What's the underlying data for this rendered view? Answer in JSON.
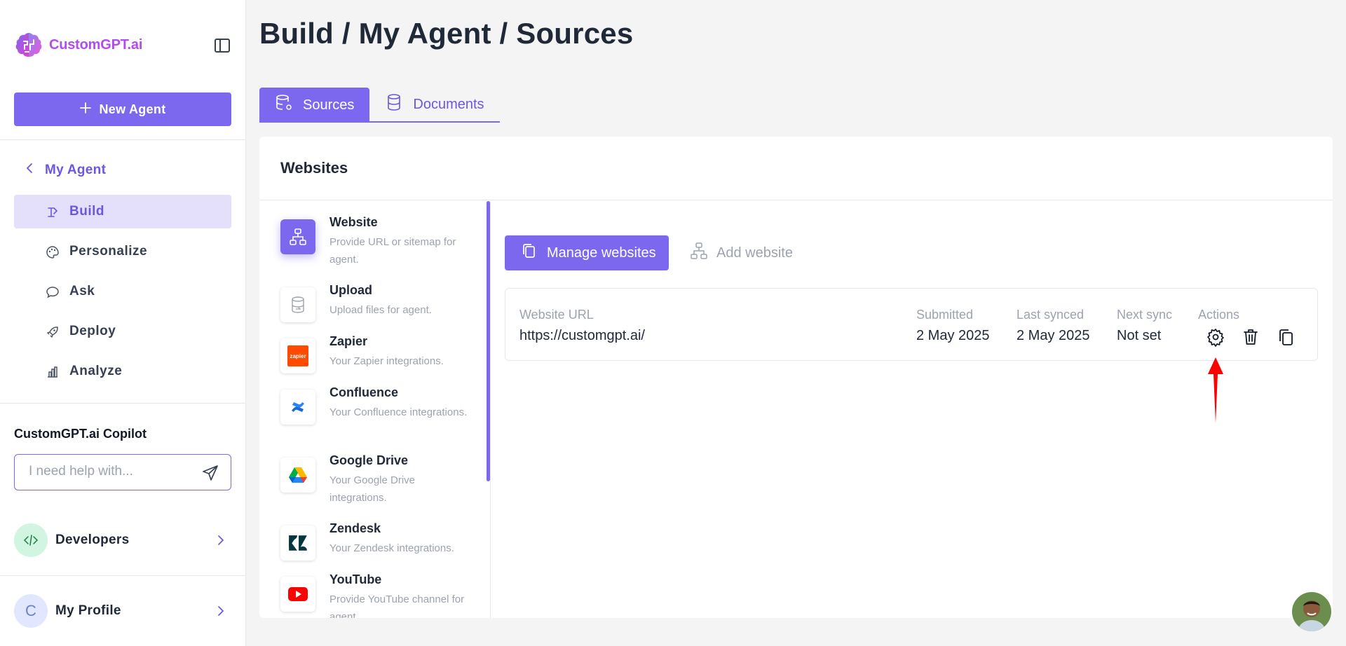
{
  "brand": {
    "name": "CustomGPT.ai"
  },
  "sidebar": {
    "new_agent": "New Agent",
    "back_label": "My Agent",
    "nav": [
      {
        "label": "Build",
        "icon": "build-icon",
        "active": true
      },
      {
        "label": "Personalize",
        "icon": "palette-icon",
        "active": false
      },
      {
        "label": "Ask",
        "icon": "chat-icon",
        "active": false
      },
      {
        "label": "Deploy",
        "icon": "rocket-icon",
        "active": false
      },
      {
        "label": "Analyze",
        "icon": "bar-chart-icon",
        "active": false
      }
    ],
    "copilot_title": "CustomGPT.ai Copilot",
    "copilot_placeholder": "I need help with...",
    "developers": "Developers",
    "profile_initial": "C",
    "profile": "My Profile"
  },
  "header": {
    "breadcrumb": "Build / My Agent / Sources"
  },
  "tabs": [
    {
      "label": "Sources",
      "active": true
    },
    {
      "label": "Documents",
      "active": false
    }
  ],
  "panel": {
    "title": "Websites",
    "sources": [
      {
        "name": "Website",
        "desc": "Provide URL or sitemap for agent.",
        "active": true
      },
      {
        "name": "Upload",
        "desc": "Upload files for agent."
      },
      {
        "name": "Zapier",
        "desc": "Your Zapier integrations.",
        "icon_text": "zapier"
      },
      {
        "name": "Confluence",
        "desc": "Your Confluence integrations."
      },
      {
        "name": "Google Drive",
        "desc": "Your Google Drive integrations."
      },
      {
        "name": "Zendesk",
        "desc": "Your Zendesk integrations."
      },
      {
        "name": "YouTube",
        "desc": "Provide YouTube channel for agent."
      }
    ],
    "manage_websites": "Manage websites",
    "add_website": "Add website",
    "table": {
      "headers": {
        "url": "Website URL",
        "submitted": "Submitted",
        "last_synced": "Last synced",
        "next_sync": "Next sync",
        "actions": "Actions"
      },
      "row": {
        "url": "https://customgpt.ai/",
        "submitted": "2 May 2025",
        "last_synced": "2 May 2025",
        "next_sync": "Not set"
      }
    }
  },
  "colors": {
    "accent": "#7b68ee",
    "accent_light": "#e4e0fc",
    "arrow": "#ff0000"
  }
}
